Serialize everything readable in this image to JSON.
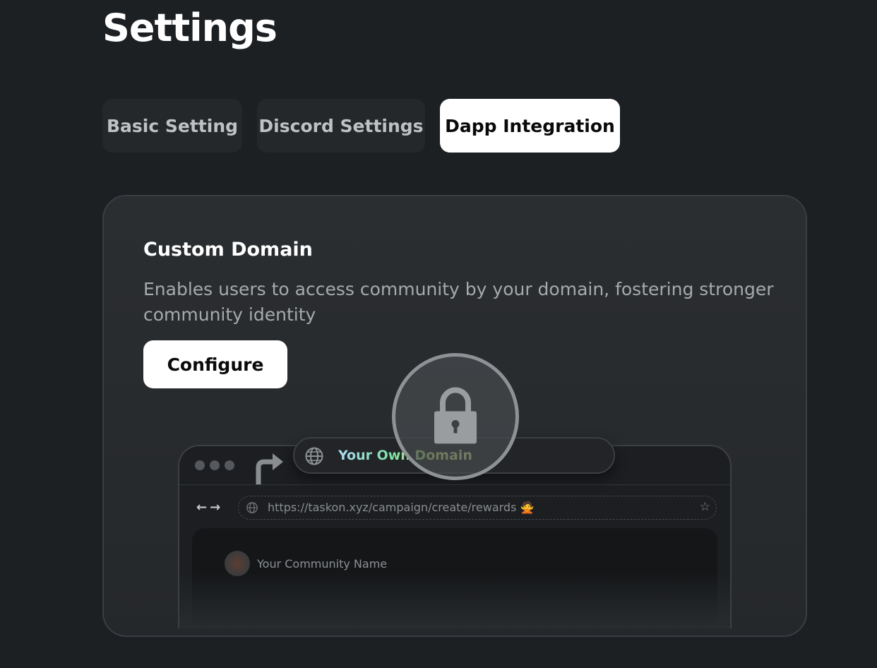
{
  "page": {
    "title": "Settings"
  },
  "tabs": [
    {
      "label": "Basic Setting",
      "active": false
    },
    {
      "label": "Discord Settings",
      "active": false
    },
    {
      "label": "Dapp Integration",
      "active": true
    }
  ],
  "custom_domain": {
    "title": "Custom Domain",
    "description": "Enables users to access community by your domain, fostering stronger community identity",
    "configure_label": "Configure",
    "locked": true
  },
  "illustration": {
    "domain_pill_text": "Your Own Domain",
    "url": "https://taskon.xyz/campaign/create/rewards 🙅",
    "community_name": "Your Community Name",
    "nav_arrows": "←→",
    "star_glyph": "☆"
  },
  "colors": {
    "background": "#1d2023",
    "active_tab": "#ffffff",
    "inactive_tab": "#25282b",
    "card": "#2b2e31"
  },
  "icons": [
    "globe-icon",
    "lock-icon",
    "redirect-arrow-icon",
    "star-icon",
    "back-arrow-icon",
    "forward-arrow-icon"
  ]
}
